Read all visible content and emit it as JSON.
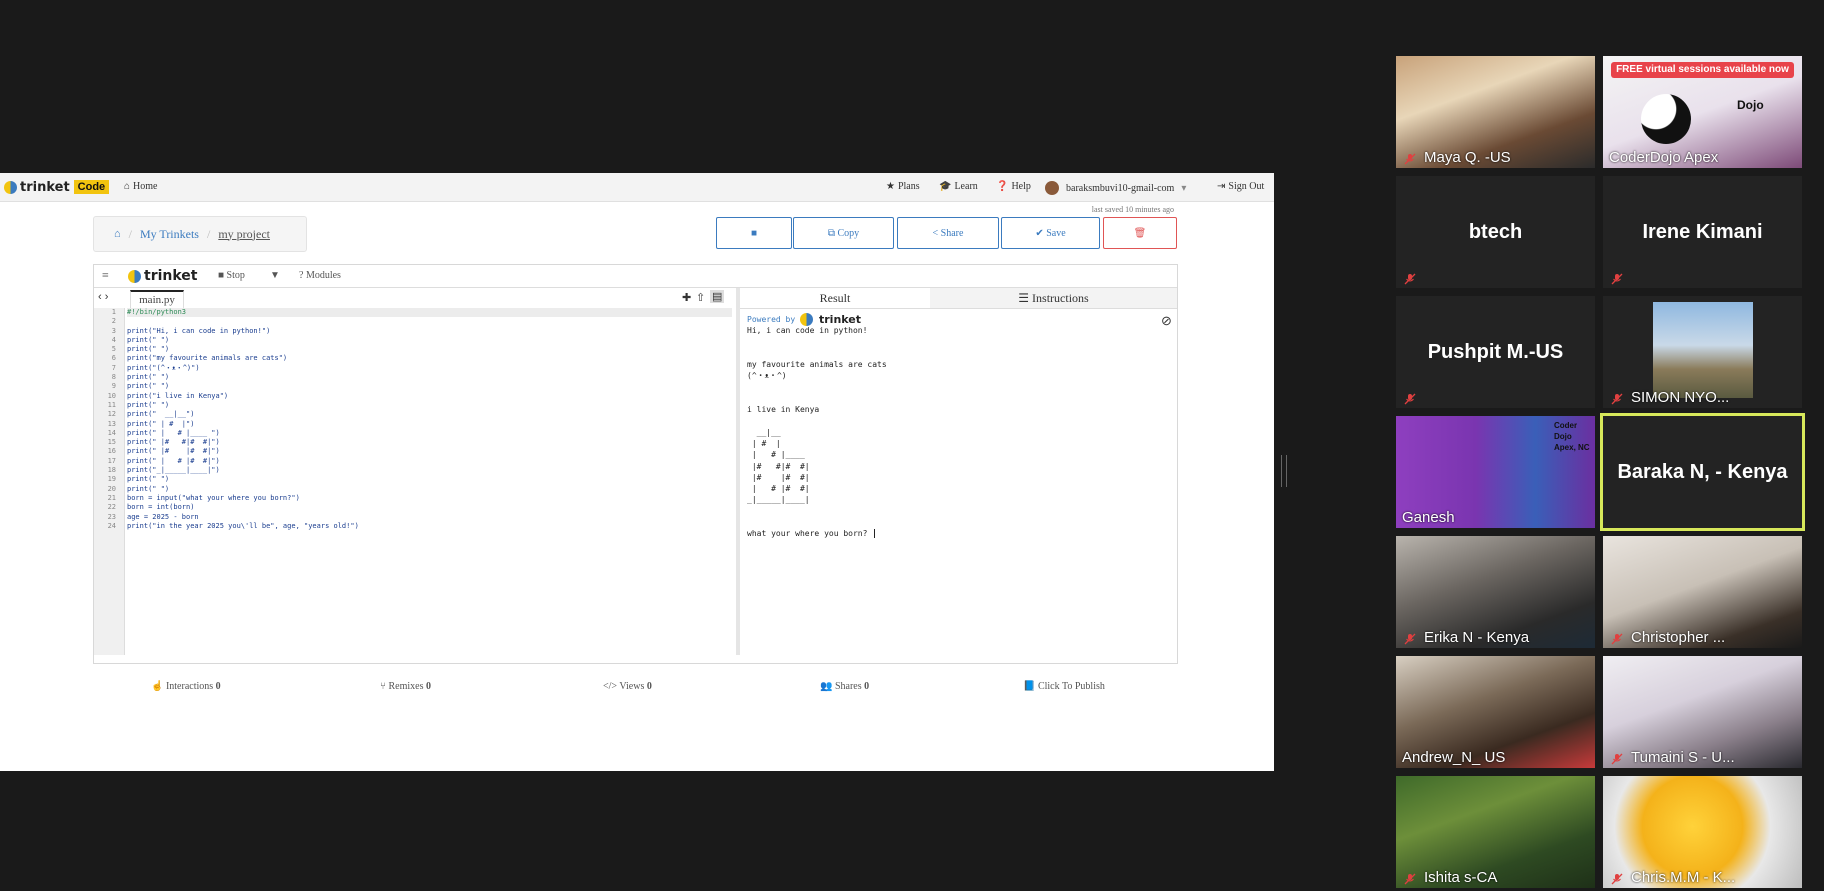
{
  "topbar": {
    "logo_text": "trinket",
    "logo_code": "Code",
    "home": "Home",
    "plans": "Plans",
    "learn": "Learn",
    "help": "Help",
    "user": "baraksmbuvi10-gmail-com",
    "signout": "Sign Out"
  },
  "saved_text": "last saved 10 minutes ago",
  "breadcrumb": {
    "my_trinkets": "My Trinkets",
    "project": "my project"
  },
  "actions": {
    "copy": "Copy",
    "share": "Share",
    "save": "Save"
  },
  "editor": {
    "brand": "trinket",
    "stop": "Stop",
    "modules": "Modules",
    "tab": "main.py",
    "line_numbers": [
      "1",
      "2",
      "3",
      "4",
      "5",
      "6",
      "7",
      "8",
      "9",
      "10",
      "11",
      "12",
      "13",
      "14",
      "15",
      "16",
      "17",
      "18",
      "19",
      "20",
      "21",
      "22",
      "23",
      "24"
    ],
    "lines": [
      "#!/bin/python3",
      "",
      "print(\"Hi, i can code in python!\")",
      "print(\" \")",
      "print(\" \")",
      "print(\"my favourite animals are cats\")",
      "print(\"(^・ᴥ・^)\")",
      "print(\" \")",
      "print(\" \")",
      "print(\"i live in Kenya\")",
      "print(\" \")",
      "print(\"  __|__\")",
      "print(\" | #  |\")",
      "print(\" |   # |____ \")",
      "print(\" |#   #|#  #|\")",
      "print(\" |#    |#  #|\")",
      "print(\" |   # |#  #|\")",
      "print(\"_|_____|____|\")",
      "print(\" \")",
      "print(\" \")",
      "born = input(\"what your where you born?\")",
      "born = int(born)",
      "age = 2025 - born",
      "print(\"in the year 2025 you\\'ll be\", age, \"years old!\")"
    ]
  },
  "result": {
    "tab_result": "Result",
    "tab_instructions": "Instructions",
    "powered_by": "Powered by",
    "brand": "trinket",
    "output": [
      "Hi, i can code in python!",
      "",
      "",
      "my favourite animals are cats",
      "(^・ᴥ・^)",
      "",
      "",
      "i live in Kenya",
      "",
      "  __|__",
      " | #  |",
      " |   # |____",
      " |#   #|#  #|",
      " |#    |#  #|",
      " |   # |#  #|",
      "_|_____|____|",
      "",
      "",
      "what your where you born? "
    ]
  },
  "stats": {
    "interactions": "Interactions",
    "interactions_count": "0",
    "remixes": "Remixes",
    "remixes_count": "0",
    "views": "Views",
    "views_count": "0",
    "shares": "Shares",
    "shares_count": "0",
    "publish": "Click To Publish"
  },
  "participants": [
    {
      "name": "Maya Q. -US"
    },
    {
      "name": "CoderDojo Apex",
      "banner": "FREE virtual sessions available now",
      "overlay": "Dojo"
    },
    {
      "name": "btech"
    },
    {
      "name": "Irene Kimani"
    },
    {
      "name": "Pushpit M.-US"
    },
    {
      "name": "SIMON NYO..."
    },
    {
      "name": "Ganesh",
      "overlay": "Coder Dojo Apex, NC"
    },
    {
      "name": "Baraka N, - Kenya"
    },
    {
      "name": "Erika N - Kenya"
    },
    {
      "name": "Christopher ..."
    },
    {
      "name": "Andrew_N_ US"
    },
    {
      "name": "Tumaini S - U..."
    },
    {
      "name": "Ishita s-CA"
    },
    {
      "name": "Chris.M.M - K..."
    }
  ],
  "colors": {
    "accent": "#3b7bbf",
    "danger": "#e05555",
    "brand_yellow": "#f2c40f",
    "active_speaker": "#d7e85a"
  }
}
